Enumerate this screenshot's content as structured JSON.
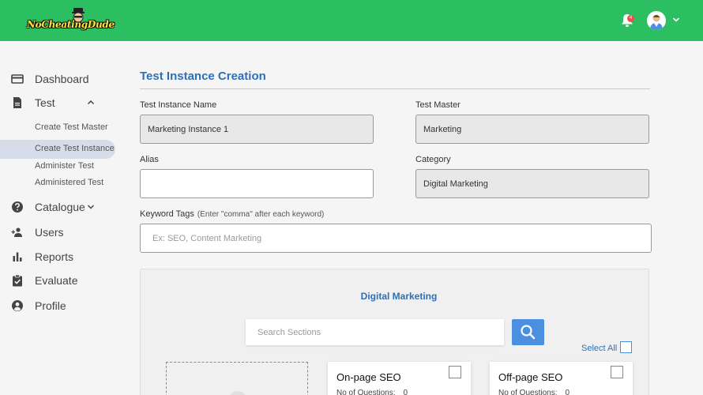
{
  "header": {
    "logo_text": "NoCheatingDude",
    "notification_count": "4",
    "colors": {
      "topbar": "#2bbf62",
      "accent": "#2f6fb7",
      "button": "#4a8fe0"
    }
  },
  "sidebar": {
    "items": [
      {
        "label": "Dashboard",
        "icon": "card-icon"
      },
      {
        "label": "Test",
        "icon": "document-icon"
      },
      {
        "label": "Catalogue",
        "icon": "help-icon"
      },
      {
        "label": "Users",
        "icon": "users-icon"
      },
      {
        "label": "Reports",
        "icon": "bar-chart-icon"
      },
      {
        "label": "Evaluate",
        "icon": "clipboard-check-icon"
      },
      {
        "label": "Profile",
        "icon": "account-icon"
      }
    ],
    "test_submenu": [
      {
        "label": "Create Test Master"
      },
      {
        "label": "Create Test Instance",
        "active": true
      },
      {
        "label": "Administer Test"
      },
      {
        "label": "Administered Test"
      }
    ]
  },
  "main": {
    "title": "Test Instance Creation",
    "fields": {
      "instance_name": {
        "label": "Test Instance Name",
        "value": "Marketing Instance 1"
      },
      "test_master": {
        "label": "Test Master",
        "value": "Marketing"
      },
      "alias": {
        "label": "Alias",
        "value": ""
      },
      "category": {
        "label": "Category",
        "value": "Digital Marketing"
      },
      "keyword_tags": {
        "label": "Keyword Tags",
        "hint": "(Enter \"comma\" after each keyword)",
        "placeholder": "Ex: SEO, Content Marketing"
      }
    },
    "sections_panel": {
      "title": "Digital Marketing",
      "search_placeholder": "Search Sections",
      "select_all_label": "Select All",
      "cards": [
        {
          "title": "On-page SEO",
          "meta_label": "No of Questions:",
          "meta_value": "0"
        },
        {
          "title": "Off-page SEO",
          "meta_label": "No of Questions:",
          "meta_value": "0"
        }
      ]
    }
  }
}
